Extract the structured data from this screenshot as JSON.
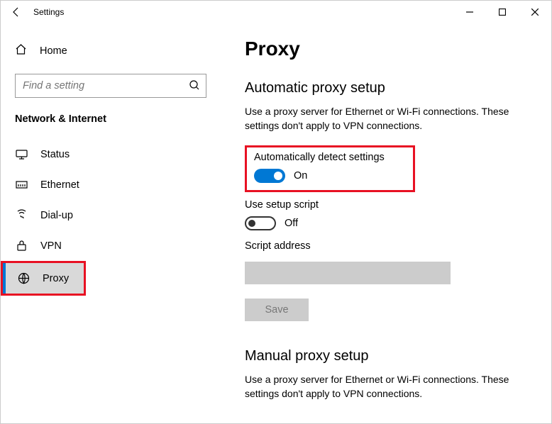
{
  "window": {
    "title": "Settings"
  },
  "sidebar": {
    "home_label": "Home",
    "search_placeholder": "Find a setting",
    "section_header": "Network & Internet",
    "items": [
      {
        "label": "Status"
      },
      {
        "label": "Ethernet"
      },
      {
        "label": "Dial-up"
      },
      {
        "label": "VPN"
      },
      {
        "label": "Proxy"
      }
    ]
  },
  "main": {
    "page_title": "Proxy",
    "auto": {
      "title": "Automatic proxy setup",
      "desc": "Use a proxy server for Ethernet or Wi-Fi connections. These settings don't apply to VPN connections.",
      "detect_label": "Automatically detect settings",
      "detect_state": "On",
      "script_label": "Use setup script",
      "script_state": "Off",
      "address_label": "Script address",
      "save_label": "Save"
    },
    "manual": {
      "title": "Manual proxy setup",
      "desc": "Use a proxy server for Ethernet or Wi-Fi connections. These settings don't apply to VPN connections."
    }
  }
}
